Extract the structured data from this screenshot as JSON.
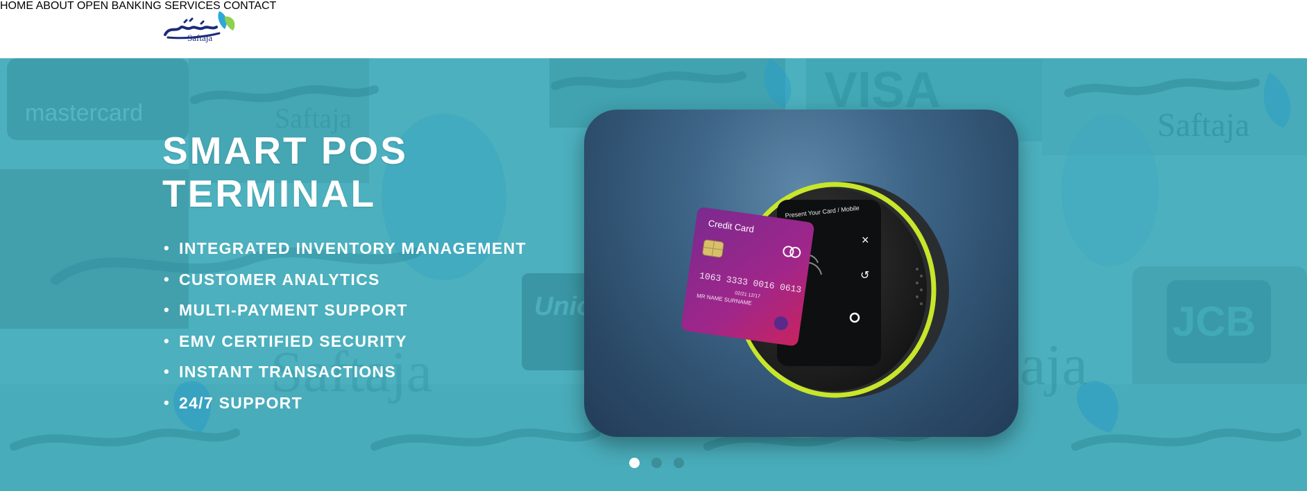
{
  "brand": {
    "name": "Saftaja",
    "colors": {
      "navy": "#1c2a7a",
      "leaf_blue": "#2fa8d8",
      "leaf_green": "#8fd14f"
    }
  },
  "nav": {
    "items": [
      {
        "label": "HOME"
      },
      {
        "label": "ABOUT"
      },
      {
        "label": "OPEN BANKING SERVICES"
      },
      {
        "label": "CONTACT"
      }
    ]
  },
  "hero": {
    "title_line1": "SMART POS",
    "title_line2": "TERMINAL",
    "features": [
      "INTEGRATED INVENTORY MANAGEMENT",
      "CUSTOMER ANALYTICS",
      "MULTI-PAYMENT SUPPORT",
      "EMV CERTIFIED SECURITY",
      "INSTANT TRANSACTIONS",
      "24/7 SUPPORT"
    ],
    "background_color": "#4cb0be",
    "background_logos": [
      "mastercard",
      "VISA",
      "JCB",
      "Unio",
      "Saftaja",
      "aja"
    ]
  },
  "product_image": {
    "card_label": "Credit Card",
    "card_number": "1063 3333 0016 0613",
    "card_expiry": "02/21 12/17",
    "card_holder": "MR NAME SURNAME",
    "screen_text": "Present Your Card / Mobile",
    "device_ring_color": "#c8e62a"
  },
  "slider": {
    "active_index": 0,
    "dot_count": 3,
    "active_color": "#ffffff",
    "inactive_color": "#3c8e99"
  }
}
